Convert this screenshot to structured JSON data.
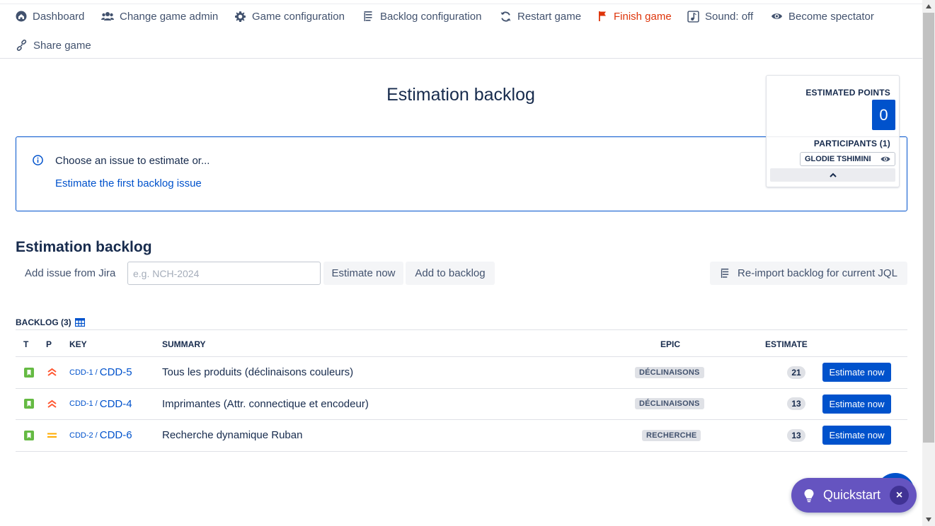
{
  "nav": {
    "dashboard": "Dashboard",
    "change_admin": "Change game admin",
    "game_config": "Game configuration",
    "backlog_config": "Backlog configuration",
    "restart": "Restart game",
    "finish": "Finish game",
    "sound": "Sound: off",
    "spectator": "Become spectator",
    "share": "Share game"
  },
  "page_title": "Estimation backlog",
  "info": {
    "text": "Choose an issue to estimate or...",
    "link": "Estimate the first backlog issue"
  },
  "stats": {
    "estimated_points_label": "ESTIMATED POINTS",
    "estimated_points_value": "0",
    "participants_label": "PARTICIPANTS (1)",
    "participant_name": "GLODIE TSHIMINI"
  },
  "backlog_section": {
    "title": "Estimation backlog",
    "add_label": "Add issue from Jira",
    "input_placeholder": "e.g. NCH-2024",
    "estimate_now": "Estimate now",
    "add_to_backlog": "Add to backlog",
    "reimport": "Re-import backlog for current JQL"
  },
  "table": {
    "count_label": "BACKLOG (3)",
    "headers": {
      "type": "T",
      "priority": "P",
      "key": "KEY",
      "summary": "SUMMARY",
      "epic": "EPIC",
      "estimate": "ESTIMATE"
    },
    "rows": [
      {
        "parent": "CDD-1 /",
        "key": "CDD-5",
        "summary": "Tous les produits (déclinaisons couleurs)",
        "epic": "DÉCLINAISONS",
        "estimate": "21",
        "priority": "high",
        "action": "Estimate now"
      },
      {
        "parent": "CDD-1 /",
        "key": "CDD-4",
        "summary": "Imprimantes (Attr. connectique et encodeur)",
        "epic": "DÉCLINAISONS",
        "estimate": "13",
        "priority": "high",
        "action": "Estimate now"
      },
      {
        "parent": "CDD-2 /",
        "key": "CDD-6",
        "summary": "Recherche dynamique Ruban",
        "epic": "RECHERCHE",
        "estimate": "13",
        "priority": "medium",
        "action": "Estimate now"
      }
    ]
  },
  "quickstart": {
    "label": "Quickstart",
    "close": "×"
  },
  "colors": {
    "primary": "#0052cc",
    "danger": "#de350b",
    "story": "#65ba43",
    "priority_high": "#ff5630",
    "priority_medium": "#ffab00",
    "quickstart": "#6554c0"
  }
}
